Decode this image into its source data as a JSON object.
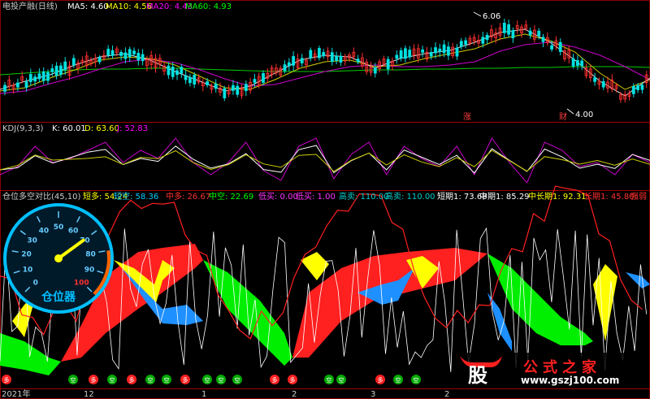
{
  "main": {
    "title": "电投产融(日线)",
    "ma": [
      {
        "label": "MA5: 4.60",
        "color": "#ffffff"
      },
      {
        "label": "MA10: 4.56",
        "color": "#ffff00"
      },
      {
        "label": "MA20: 4.43",
        "color": "#ff00ff"
      },
      {
        "label": "MA60: 4.93",
        "color": "#00ff00"
      }
    ],
    "high_mark": "6.06",
    "low_mark": "4.00",
    "badges": [
      "涨",
      "财"
    ]
  },
  "kdj": {
    "title": "KDJ(9,3,3)",
    "k_label": "K: 60.01",
    "d_label": "D: 63.60",
    "j_label": "J: 52.83"
  },
  "indicator": {
    "title": "仓位多空对比(45,10)",
    "readouts": [
      {
        "label": "短多: 54.24",
        "color": "#ffff00"
      },
      {
        "label": "短空: 58.36",
        "color": "#00ccff"
      },
      {
        "label": "中多: 26.67",
        "color": "#ff3030"
      },
      {
        "label": "中空: 22.69",
        "color": "#00ff00"
      },
      {
        "label": "低买: 0.00",
        "color": "#ff33ff"
      },
      {
        "label": "低买: 1.00",
        "color": "#ff33ff"
      },
      {
        "label": "高卖: 110.00",
        "color": "#00cccc"
      },
      {
        "label": "高卖: 110.00",
        "color": "#00cccc"
      },
      {
        "label": "短期1: 73.68",
        "color": "#ffffff"
      },
      {
        "label": "中期1: 85.29",
        "color": "#ffffff"
      },
      {
        "label": "中长期1: 92.31",
        "color": "#ffff00"
      },
      {
        "label": "长期1: 45.80",
        "color": "#ff3030"
      },
      {
        "label": "强弱",
        "color": "#ff3030"
      }
    ],
    "gauge": {
      "title": "仓位器",
      "value": 70,
      "ticks": [
        "0",
        "10",
        "20",
        "30",
        "40",
        "50",
        "60",
        "70",
        "80",
        "90",
        "100"
      ]
    },
    "markers": [
      "多",
      "空"
    ]
  },
  "axis": {
    "labels": [
      "2021年",
      "12",
      "1",
      "2",
      "3",
      "2"
    ]
  },
  "watermark": {
    "glyph": "股",
    "title": "公式之家",
    "url": "www.gszj100.com"
  }
}
